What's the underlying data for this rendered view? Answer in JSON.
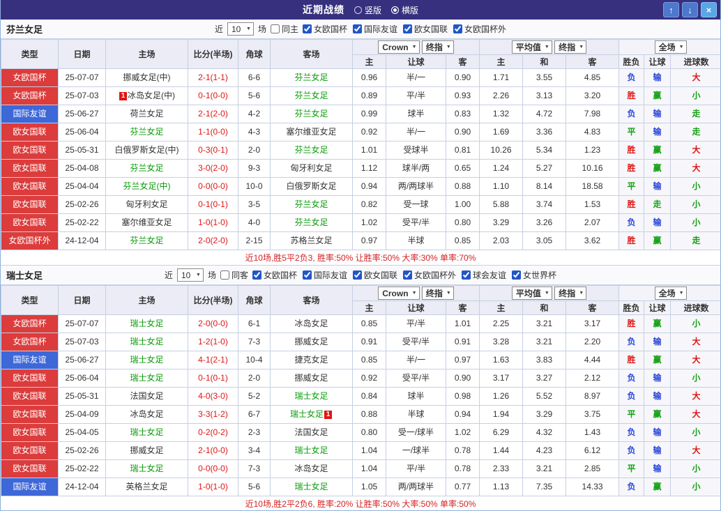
{
  "topbar": {
    "title": "近期战绩",
    "layout_options": [
      {
        "label": "竖版",
        "selected": false
      },
      {
        "label": "横版",
        "selected": true
      }
    ],
    "window_buttons": [
      {
        "name": "up",
        "glyph": "↑"
      },
      {
        "name": "down",
        "glyph": "↓"
      },
      {
        "name": "close",
        "glyph": "×"
      }
    ]
  },
  "table_head": {
    "main": [
      "类型",
      "日期",
      "主场",
      "比分(半场)",
      "角球",
      "客场"
    ],
    "sub": [
      "主",
      "让球",
      "客",
      "主",
      "和",
      "客",
      "胜负",
      "让球",
      "进球数"
    ]
  },
  "sections": [
    {
      "team": "芬兰女足",
      "filters": {
        "near": "近",
        "count": "10",
        "games": "场",
        "scope": {
          "label": "同主",
          "checked": false
        },
        "leagues": [
          {
            "label": "女欧国杯",
            "checked": true
          },
          {
            "label": "国际友谊",
            "checked": true
          },
          {
            "label": "欧女国联",
            "checked": true
          },
          {
            "label": "女欧国杯外",
            "checked": true
          }
        ]
      },
      "selectors": {
        "asia_source": "Crown",
        "asia_period": "终指",
        "euro_source": "平均值",
        "euro_period": "终指",
        "scope": "全场"
      },
      "rows": [
        {
          "type": "女欧国杯",
          "tc": "r",
          "date": "25-07-07",
          "home": "挪威女足(中)",
          "hf": false,
          "score": "2-1(1-1)",
          "corner": "6-6",
          "away": "芬兰女足",
          "af": true,
          "asia": [
            "0.96",
            "半/一",
            "0.90"
          ],
          "euro": [
            "1.71",
            "3.55",
            "4.85"
          ],
          "res": [
            [
              "负",
              "b"
            ],
            [
              "输",
              "b"
            ],
            [
              "大",
              "r"
            ]
          ]
        },
        {
          "type": "女欧国杯",
          "tc": "r",
          "date": "25-07-03",
          "home": "冰岛女足(中)",
          "hf": false,
          "hb": "1",
          "score": "0-1(0-0)",
          "corner": "5-6",
          "away": "芬兰女足",
          "af": true,
          "asia": [
            "0.89",
            "平/半",
            "0.93"
          ],
          "euro": [
            "2.26",
            "3.13",
            "3.20"
          ],
          "res": [
            [
              "胜",
              "r"
            ],
            [
              "赢",
              "g"
            ],
            [
              "小",
              "g"
            ]
          ]
        },
        {
          "type": "国际友谊",
          "tc": "b",
          "date": "25-06-27",
          "home": "荷兰女足",
          "hf": false,
          "score": "2-1(2-0)",
          "corner": "4-2",
          "away": "芬兰女足",
          "af": true,
          "asia": [
            "0.99",
            "球半",
            "0.83"
          ],
          "euro": [
            "1.32",
            "4.72",
            "7.98"
          ],
          "res": [
            [
              "负",
              "b"
            ],
            [
              "输",
              "b"
            ],
            [
              "走",
              "g"
            ]
          ]
        },
        {
          "type": "欧女国联",
          "tc": "r",
          "date": "25-06-04",
          "home": "芬兰女足",
          "hf": true,
          "score": "1-1(0-0)",
          "corner": "4-3",
          "away": "塞尔维亚女足",
          "af": false,
          "asia": [
            "0.92",
            "半/一",
            "0.90"
          ],
          "euro": [
            "1.69",
            "3.36",
            "4.83"
          ],
          "res": [
            [
              "平",
              "g"
            ],
            [
              "输",
              "b"
            ],
            [
              "走",
              "g"
            ]
          ]
        },
        {
          "type": "欧女国联",
          "tc": "r",
          "date": "25-05-31",
          "home": "白俄罗斯女足(中)",
          "hf": false,
          "score": "0-3(0-1)",
          "corner": "2-0",
          "away": "芬兰女足",
          "af": true,
          "asia": [
            "1.01",
            "受球半",
            "0.81"
          ],
          "euro": [
            "10.26",
            "5.34",
            "1.23"
          ],
          "res": [
            [
              "胜",
              "r"
            ],
            [
              "赢",
              "g"
            ],
            [
              "大",
              "r"
            ]
          ]
        },
        {
          "type": "欧女国联",
          "tc": "r",
          "date": "25-04-08",
          "home": "芬兰女足",
          "hf": true,
          "score": "3-0(2-0)",
          "corner": "9-3",
          "away": "匈牙利女足",
          "af": false,
          "asia": [
            "1.12",
            "球半/两",
            "0.65"
          ],
          "euro": [
            "1.24",
            "5.27",
            "10.16"
          ],
          "res": [
            [
              "胜",
              "r"
            ],
            [
              "赢",
              "g"
            ],
            [
              "大",
              "r"
            ]
          ]
        },
        {
          "type": "欧女国联",
          "tc": "r",
          "date": "25-04-04",
          "home": "芬兰女足(中)",
          "hf": true,
          "score": "0-0(0-0)",
          "corner": "10-0",
          "away": "白俄罗斯女足",
          "af": false,
          "asia": [
            "0.94",
            "两/两球半",
            "0.88"
          ],
          "euro": [
            "1.10",
            "8.14",
            "18.58"
          ],
          "res": [
            [
              "平",
              "g"
            ],
            [
              "输",
              "b"
            ],
            [
              "小",
              "g"
            ]
          ]
        },
        {
          "type": "欧女国联",
          "tc": "r",
          "date": "25-02-26",
          "home": "匈牙利女足",
          "hf": false,
          "score": "0-1(0-1)",
          "corner": "3-5",
          "away": "芬兰女足",
          "af": true,
          "asia": [
            "0.82",
            "受一球",
            "1.00"
          ],
          "euro": [
            "5.88",
            "3.74",
            "1.53"
          ],
          "res": [
            [
              "胜",
              "r"
            ],
            [
              "走",
              "g"
            ],
            [
              "小",
              "g"
            ]
          ]
        },
        {
          "type": "欧女国联",
          "tc": "r",
          "date": "25-02-22",
          "home": "塞尔维亚女足",
          "hf": false,
          "score": "1-0(1-0)",
          "corner": "4-0",
          "away": "芬兰女足",
          "af": true,
          "asia": [
            "1.02",
            "受平/半",
            "0.80"
          ],
          "euro": [
            "3.29",
            "3.26",
            "2.07"
          ],
          "res": [
            [
              "负",
              "b"
            ],
            [
              "输",
              "b"
            ],
            [
              "小",
              "g"
            ]
          ]
        },
        {
          "type": "女欧国杯外",
          "tc": "r",
          "date": "24-12-04",
          "home": "芬兰女足",
          "hf": true,
          "score": "2-0(2-0)",
          "corner": "2-15",
          "away": "苏格兰女足",
          "af": false,
          "asia": [
            "0.97",
            "半球",
            "0.85"
          ],
          "euro": [
            "2.03",
            "3.05",
            "3.62"
          ],
          "res": [
            [
              "胜",
              "r"
            ],
            [
              "赢",
              "g"
            ],
            [
              "走",
              "g"
            ]
          ]
        }
      ],
      "summary": "近10场,胜5平2负3, 胜率:50%  让胜率:50%  大率:30%  单率:70%"
    },
    {
      "team": "瑞士女足",
      "filters": {
        "near": "近",
        "count": "10",
        "games": "场",
        "scope": {
          "label": "同客",
          "checked": false
        },
        "leagues": [
          {
            "label": "女欧国杯",
            "checked": true
          },
          {
            "label": "国际友谊",
            "checked": true
          },
          {
            "label": "欧女国联",
            "checked": true
          },
          {
            "label": "女欧国杯外",
            "checked": true
          },
          {
            "label": "球会友谊",
            "checked": true
          },
          {
            "label": "女世界杯",
            "checked": true
          }
        ]
      },
      "selectors": {
        "asia_source": "Crown",
        "asia_period": "终指",
        "euro_source": "平均值",
        "euro_period": "终指",
        "scope": "全场"
      },
      "rows": [
        {
          "type": "女欧国杯",
          "tc": "r",
          "date": "25-07-07",
          "home": "瑞士女足",
          "hf": true,
          "score": "2-0(0-0)",
          "corner": "6-1",
          "away": "冰岛女足",
          "af": false,
          "asia": [
            "0.85",
            "平/半",
            "1.01"
          ],
          "euro": [
            "2.25",
            "3.21",
            "3.17"
          ],
          "res": [
            [
              "胜",
              "r"
            ],
            [
              "赢",
              "g"
            ],
            [
              "小",
              "g"
            ]
          ]
        },
        {
          "type": "女欧国杯",
          "tc": "r",
          "date": "25-07-03",
          "home": "瑞士女足",
          "hf": true,
          "score": "1-2(1-0)",
          "corner": "7-3",
          "away": "挪威女足",
          "af": false,
          "asia": [
            "0.91",
            "受平/半",
            "0.91"
          ],
          "euro": [
            "3.28",
            "3.21",
            "2.20"
          ],
          "res": [
            [
              "负",
              "b"
            ],
            [
              "输",
              "b"
            ],
            [
              "大",
              "r"
            ]
          ]
        },
        {
          "type": "国际友谊",
          "tc": "b",
          "date": "25-06-27",
          "home": "瑞士女足",
          "hf": true,
          "score": "4-1(2-1)",
          "corner": "10-4",
          "away": "捷克女足",
          "af": false,
          "asia": [
            "0.85",
            "半/一",
            "0.97"
          ],
          "euro": [
            "1.63",
            "3.83",
            "4.44"
          ],
          "res": [
            [
              "胜",
              "r"
            ],
            [
              "赢",
              "g"
            ],
            [
              "大",
              "r"
            ]
          ]
        },
        {
          "type": "欧女国联",
          "tc": "r",
          "date": "25-06-04",
          "home": "瑞士女足",
          "hf": true,
          "score": "0-1(0-1)",
          "corner": "2-0",
          "away": "挪威女足",
          "af": false,
          "asia": [
            "0.92",
            "受平/半",
            "0.90"
          ],
          "euro": [
            "3.17",
            "3.27",
            "2.12"
          ],
          "res": [
            [
              "负",
              "b"
            ],
            [
              "输",
              "b"
            ],
            [
              "小",
              "g"
            ]
          ]
        },
        {
          "type": "欧女国联",
          "tc": "r",
          "date": "25-05-31",
          "home": "法国女足",
          "hf": false,
          "score": "4-0(3-0)",
          "corner": "5-2",
          "away": "瑞士女足",
          "af": true,
          "asia": [
            "0.84",
            "球半",
            "0.98"
          ],
          "euro": [
            "1.26",
            "5.52",
            "8.97"
          ],
          "res": [
            [
              "负",
              "b"
            ],
            [
              "输",
              "b"
            ],
            [
              "大",
              "r"
            ]
          ]
        },
        {
          "type": "欧女国联",
          "tc": "r",
          "date": "25-04-09",
          "home": "冰岛女足",
          "hf": false,
          "score": "3-3(1-2)",
          "corner": "6-7",
          "away": "瑞士女足",
          "af": true,
          "ab": "1",
          "asia": [
            "0.88",
            "半球",
            "0.94"
          ],
          "euro": [
            "1.94",
            "3.29",
            "3.75"
          ],
          "res": [
            [
              "平",
              "g"
            ],
            [
              "赢",
              "g"
            ],
            [
              "大",
              "r"
            ]
          ]
        },
        {
          "type": "欧女国联",
          "tc": "r",
          "date": "25-04-05",
          "home": "瑞士女足",
          "hf": true,
          "score": "0-2(0-2)",
          "corner": "2-3",
          "away": "法国女足",
          "af": false,
          "asia": [
            "0.80",
            "受一/球半",
            "1.02"
          ],
          "euro": [
            "6.29",
            "4.32",
            "1.43"
          ],
          "res": [
            [
              "负",
              "b"
            ],
            [
              "输",
              "b"
            ],
            [
              "小",
              "g"
            ]
          ]
        },
        {
          "type": "欧女国联",
          "tc": "r",
          "date": "25-02-26",
          "home": "挪威女足",
          "hf": false,
          "score": "2-1(0-0)",
          "corner": "3-4",
          "away": "瑞士女足",
          "af": true,
          "asia": [
            "1.04",
            "一/球半",
            "0.78"
          ],
          "euro": [
            "1.44",
            "4.23",
            "6.12"
          ],
          "res": [
            [
              "负",
              "b"
            ],
            [
              "输",
              "b"
            ],
            [
              "大",
              "r"
            ]
          ]
        },
        {
          "type": "欧女国联",
          "tc": "r",
          "date": "25-02-22",
          "home": "瑞士女足",
          "hf": true,
          "score": "0-0(0-0)",
          "corner": "7-3",
          "away": "冰岛女足",
          "af": false,
          "asia": [
            "1.04",
            "平/半",
            "0.78"
          ],
          "euro": [
            "2.33",
            "3.21",
            "2.85"
          ],
          "res": [
            [
              "平",
              "g"
            ],
            [
              "输",
              "b"
            ],
            [
              "小",
              "g"
            ]
          ]
        },
        {
          "type": "国际友谊",
          "tc": "b",
          "date": "24-12-04",
          "home": "英格兰女足",
          "hf": false,
          "score": "1-0(1-0)",
          "corner": "5-6",
          "away": "瑞士女足",
          "af": true,
          "asia": [
            "1.05",
            "两/两球半",
            "0.77"
          ],
          "euro": [
            "1.13",
            "7.35",
            "14.33"
          ],
          "res": [
            [
              "负",
              "b"
            ],
            [
              "赢",
              "g"
            ],
            [
              "小",
              "g"
            ]
          ]
        }
      ],
      "summary": "近10场,胜2平2负6, 胜率:20%  让胜率:50%  大率:50%  单率:50%"
    }
  ]
}
